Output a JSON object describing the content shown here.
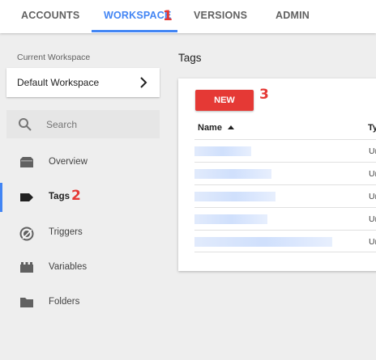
{
  "tabs": [
    {
      "label": "ACCOUNTS"
    },
    {
      "label": "WORKSPACE"
    },
    {
      "label": "VERSIONS"
    },
    {
      "label": "ADMIN"
    }
  ],
  "annotations": {
    "one": "1",
    "two": "2",
    "three": "3"
  },
  "sidebar": {
    "current_workspace_label": "Current Workspace",
    "workspace_name": "Default Workspace",
    "search_placeholder": "Search",
    "items": [
      {
        "label": "Overview",
        "icon": "overview-icon"
      },
      {
        "label": "Tags",
        "icon": "tag-icon"
      },
      {
        "label": "Triggers",
        "icon": "trigger-icon"
      },
      {
        "label": "Variables",
        "icon": "variable-icon"
      },
      {
        "label": "Folders",
        "icon": "folder-icon"
      }
    ]
  },
  "main": {
    "title": "Tags",
    "new_button": "NEW",
    "columns": [
      "Name",
      "Ty"
    ],
    "rows": [
      {
        "type": "Ur"
      },
      {
        "type": "Ur"
      },
      {
        "type": "Ur"
      },
      {
        "type": "Ur"
      },
      {
        "type": "Ur"
      }
    ]
  },
  "colors": {
    "accent": "#4285f4",
    "new_button": "#e53935",
    "annotation": "#e53935"
  }
}
